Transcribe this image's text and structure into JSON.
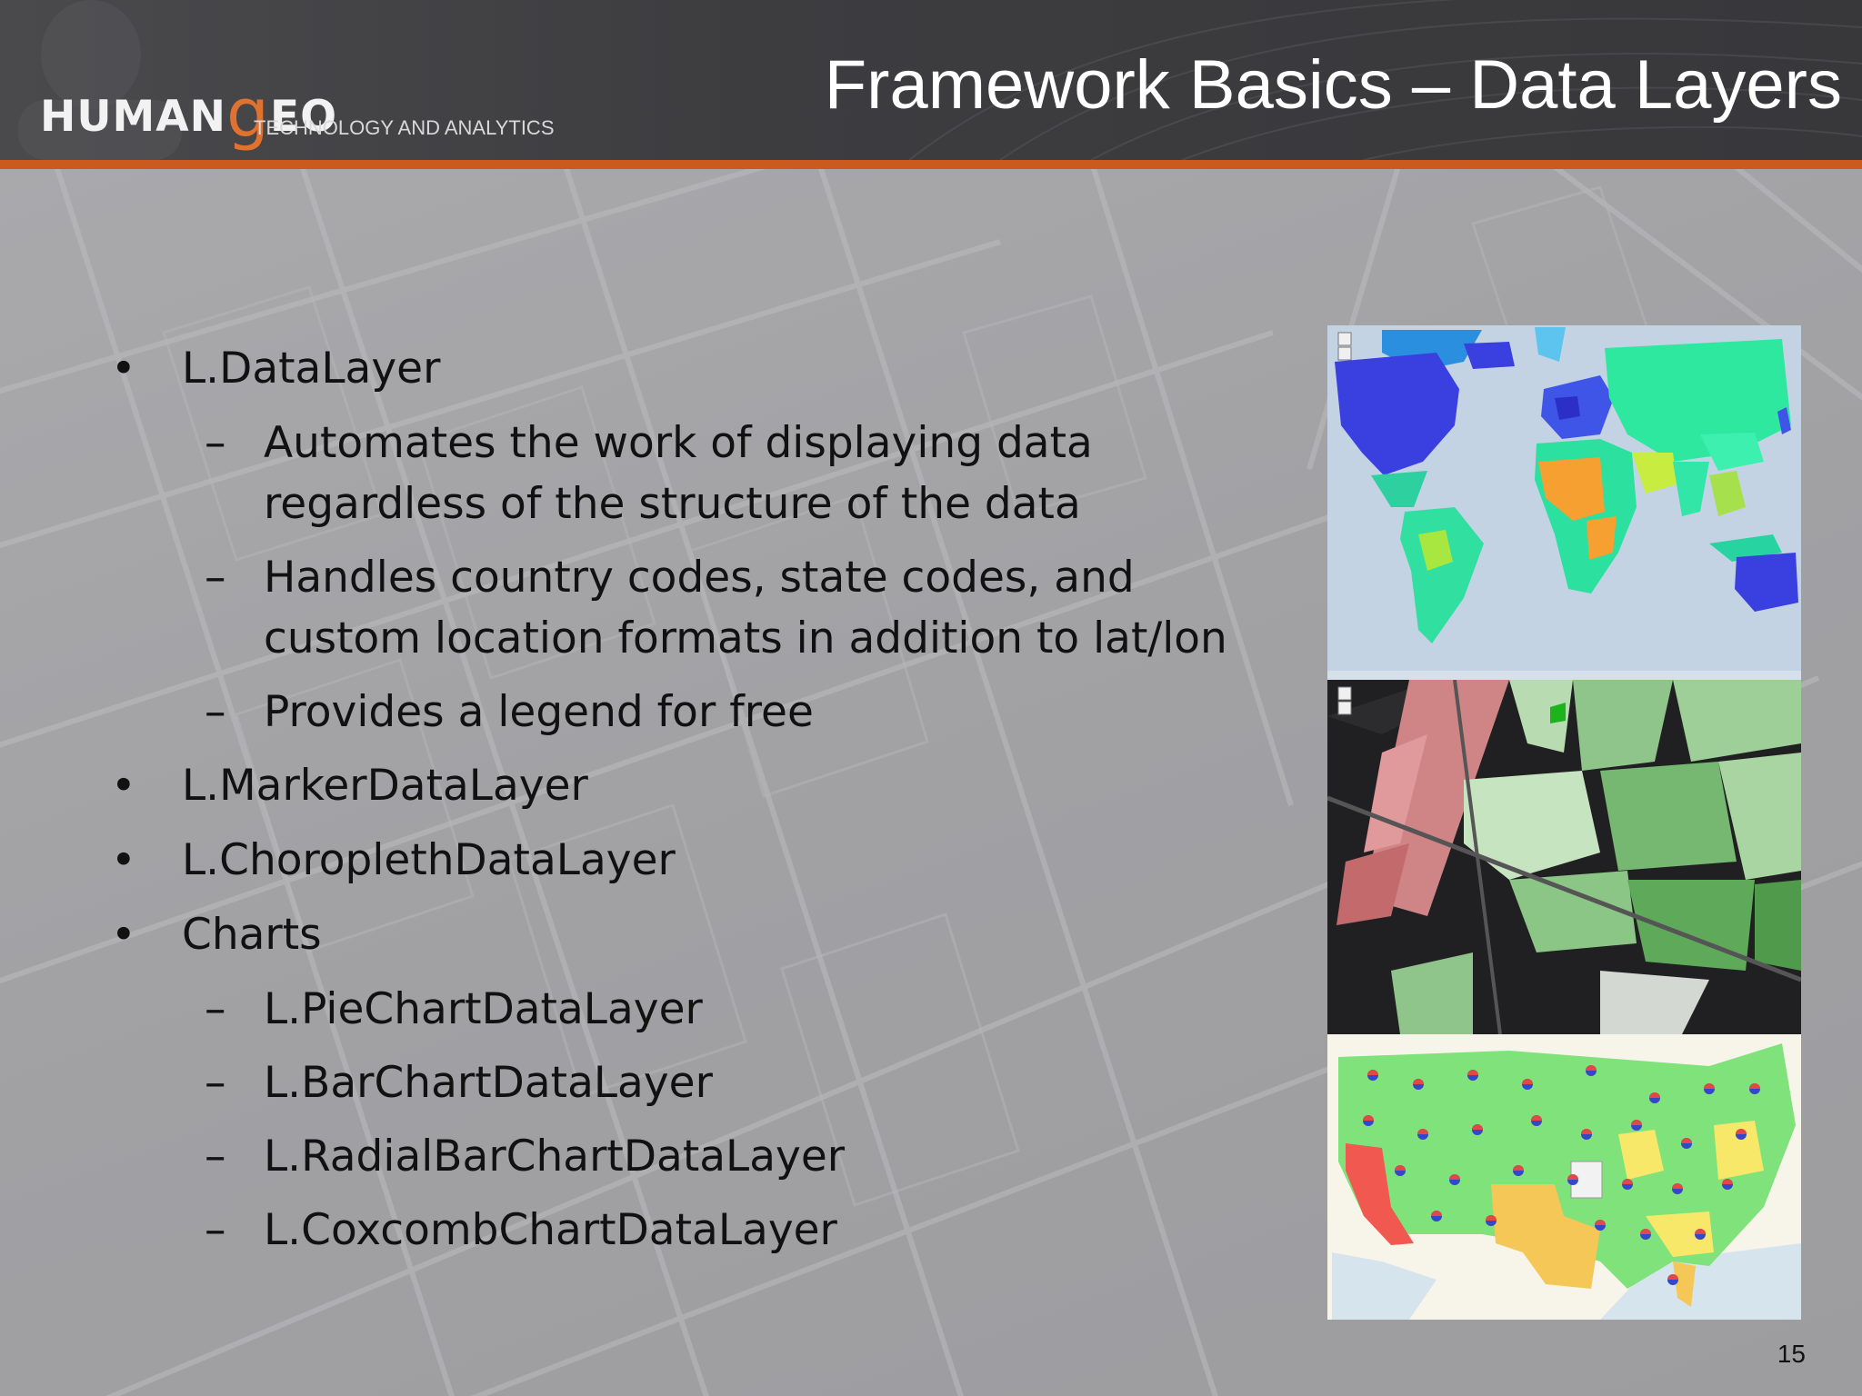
{
  "header": {
    "title": "Framework Basics – Data Layers",
    "logo": {
      "word_start": "HUMAN",
      "word_g": "g",
      "word_end": "EO",
      "tagline": "TECHNOLOGY AND ANALYTICS"
    }
  },
  "bullets": [
    {
      "level": 1,
      "text": "L.DataLayer"
    },
    {
      "level": 2,
      "text": "Automates the work of displaying data regardless of the structure of the data"
    },
    {
      "level": 2,
      "text": "Handles country codes, state codes, and custom location formats in addition to lat/lon"
    },
    {
      "level": 2,
      "text": "Provides a legend for free"
    },
    {
      "level": 1,
      "text": "L.MarkerDataLayer"
    },
    {
      "level": 1,
      "text": "L.ChoroplethDataLayer"
    },
    {
      "level": 1,
      "text": "Charts"
    },
    {
      "level": 2,
      "text": "L.PieChartDataLayer"
    },
    {
      "level": 2,
      "text": "L.BarChartDataLayer"
    },
    {
      "level": 2,
      "text": "L.RadialBarChartDataLayer"
    },
    {
      "level": 2,
      "text": "L.CoxcombChartDataLayer"
    }
  ],
  "markers": {
    "bullet": "•",
    "dash": "–"
  },
  "slide_number": "15",
  "colors": {
    "accent": "#cc5a1e",
    "header_bg": "#3d3d40",
    "slide_bg": "#a3a3a6"
  },
  "images": [
    {
      "name": "world-choropleth-map-thumbnail"
    },
    {
      "name": "city-choropleth-map-thumbnail"
    },
    {
      "name": "us-pie-chart-map-thumbnail"
    }
  ]
}
